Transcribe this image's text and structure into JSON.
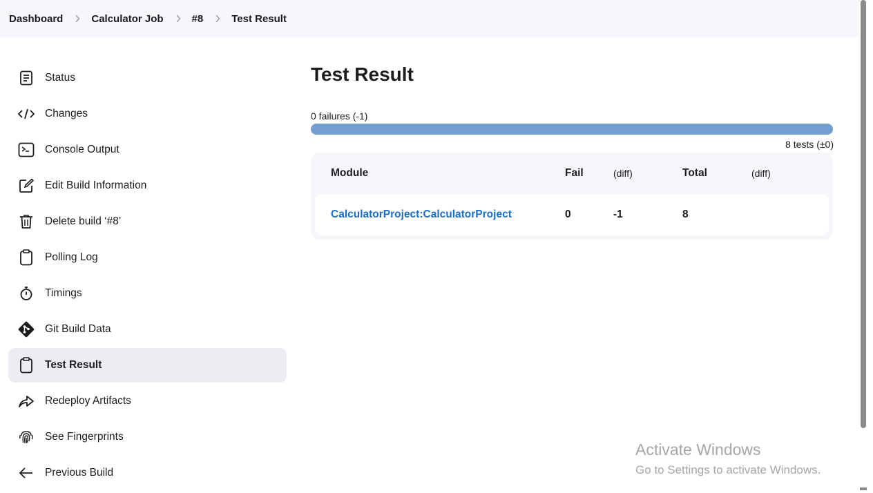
{
  "breadcrumb": {
    "items": [
      "Dashboard",
      "Calculator Job",
      "#8",
      "Test Result"
    ]
  },
  "sidebar": {
    "items": [
      {
        "label": "Status",
        "icon": "document-icon"
      },
      {
        "label": "Changes",
        "icon": "code-icon"
      },
      {
        "label": "Console Output",
        "icon": "terminal-icon"
      },
      {
        "label": "Edit Build Information",
        "icon": "edit-icon"
      },
      {
        "label": "Delete build ‘#8’",
        "icon": "trash-icon"
      },
      {
        "label": "Polling Log",
        "icon": "clipboard-icon"
      },
      {
        "label": "Timings",
        "icon": "stopwatch-icon"
      },
      {
        "label": "Git Build Data",
        "icon": "git-icon"
      },
      {
        "label": "Test Result",
        "icon": "clipboard-icon",
        "active": true
      },
      {
        "label": "Redeploy Artifacts",
        "icon": "redeploy-arrow-icon"
      },
      {
        "label": "See Fingerprints",
        "icon": "fingerprint-icon"
      },
      {
        "label": "Previous Build",
        "icon": "arrow-left-icon"
      }
    ]
  },
  "main": {
    "title": "Test Result",
    "fail_summary": "0 failures (-1)",
    "tests_summary": "8 tests (±0)",
    "fail_fraction": 0,
    "table": {
      "headers": {
        "module": "Module",
        "fail": "Fail",
        "fail_diff": "(diff)",
        "total": "Total",
        "total_diff": "(diff)"
      },
      "rows": [
        {
          "module": "CalculatorProject:CalculatorProject",
          "fail": "0",
          "fail_diff": "-1",
          "total": "8",
          "total_diff": ""
        }
      ]
    }
  },
  "watermark": {
    "title": "Activate Windows",
    "subtitle": "Go to Settings to activate Windows."
  },
  "colors": {
    "pass_bar": "#729fcf",
    "fail_bar": "#e05252",
    "link": "#1a6ec8",
    "active_bg": "#ececf3",
    "header_bg": "#f6f6fb"
  }
}
